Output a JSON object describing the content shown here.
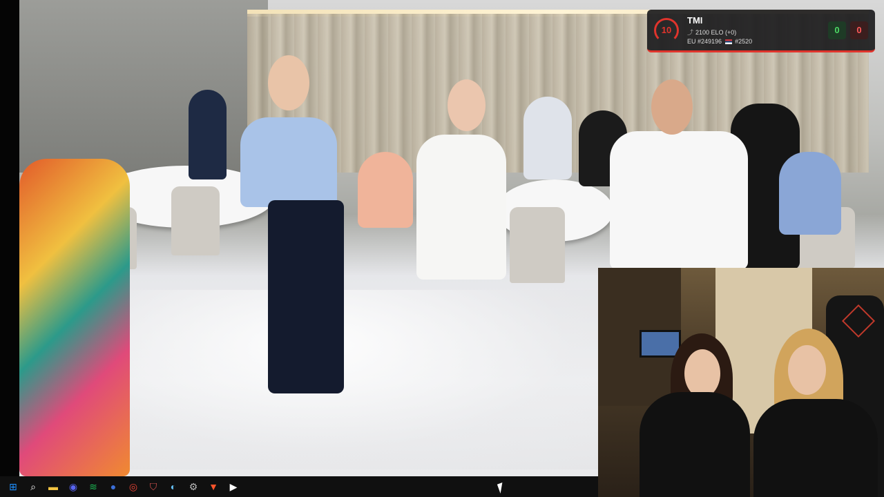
{
  "stream_overlay": {
    "faceit": {
      "level": "10",
      "username": "TMI",
      "elo": "2100 ELO (+0)",
      "region_rank": "EU #249196",
      "country_rank": "#2520",
      "wins": "0",
      "losses": "0",
      "accent_color": "#e0342c"
    }
  },
  "taskbar": {
    "icons": [
      {
        "name": "windows-start-icon",
        "color": "#1e90ff"
      },
      {
        "name": "search-icon",
        "color": "#ffffff"
      },
      {
        "name": "file-explorer-icon",
        "color": "#f4c542"
      },
      {
        "name": "discord-icon",
        "color": "#5865f2"
      },
      {
        "name": "spotify-icon",
        "color": "#1db954"
      },
      {
        "name": "app-blue-icon",
        "color": "#3b6fd8"
      },
      {
        "name": "chrome-icon",
        "color": "#ea4335"
      },
      {
        "name": "shield-app-icon",
        "color": "#d9534f"
      },
      {
        "name": "steam-icon",
        "color": "#66c0f4"
      },
      {
        "name": "settings-icon",
        "color": "#bbbbbb"
      },
      {
        "name": "brave-icon",
        "color": "#fb542b"
      },
      {
        "name": "media-player-icon",
        "color": "#ffffff"
      }
    ]
  }
}
